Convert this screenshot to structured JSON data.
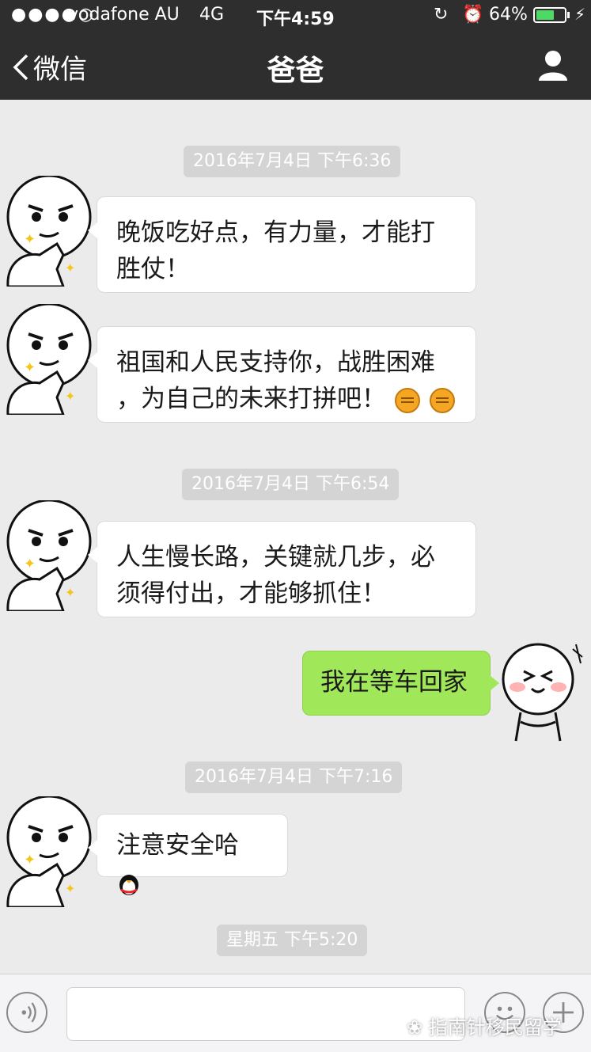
{
  "status_bar": {
    "signal": "●●●●○",
    "carrier": "vodafone AU",
    "network": "4G",
    "time": "下午4:59",
    "battery_percent": "64%",
    "battery_level": 0.64
  },
  "nav": {
    "back_label": "微信",
    "title": "爸爸"
  },
  "messages": [
    {
      "timestamp": "2016年7月4日 下午6:36"
    },
    {
      "sender": "dad",
      "text_line1": "晚饭吃好点，有力量，才能打",
      "text_line2": "胜仗！"
    },
    {
      "sender": "dad",
      "text_line1": "祖国和人民支持你，战胜困难",
      "text_line2": "，为自己的未来打拼吧！",
      "emoji": "fist-emoji x2"
    },
    {
      "timestamp": "2016年7月4日 下午6:54"
    },
    {
      "sender": "dad",
      "text_line1": "人生慢长路，关键就几步，必",
      "text_line2": "须得付出，才能够抓住！"
    },
    {
      "sender": "me",
      "text": "我在等车回家"
    },
    {
      "timestamp": "2016年7月4日 下午7:16"
    },
    {
      "sender": "dad",
      "text": "注意安全哈",
      "emoji": "penguin-emoji"
    },
    {
      "timestamp": "星期五 下午5:20"
    }
  ],
  "watermark": "指南针移民留学",
  "colors": {
    "navbar": "#2e2e2e",
    "chat_background": "#ebebeb",
    "sent_bubble": "#a0e75a",
    "received_bubble": "#ffffff",
    "timestamp_pill": "#d4d4d4",
    "battery": "#4cd964"
  }
}
